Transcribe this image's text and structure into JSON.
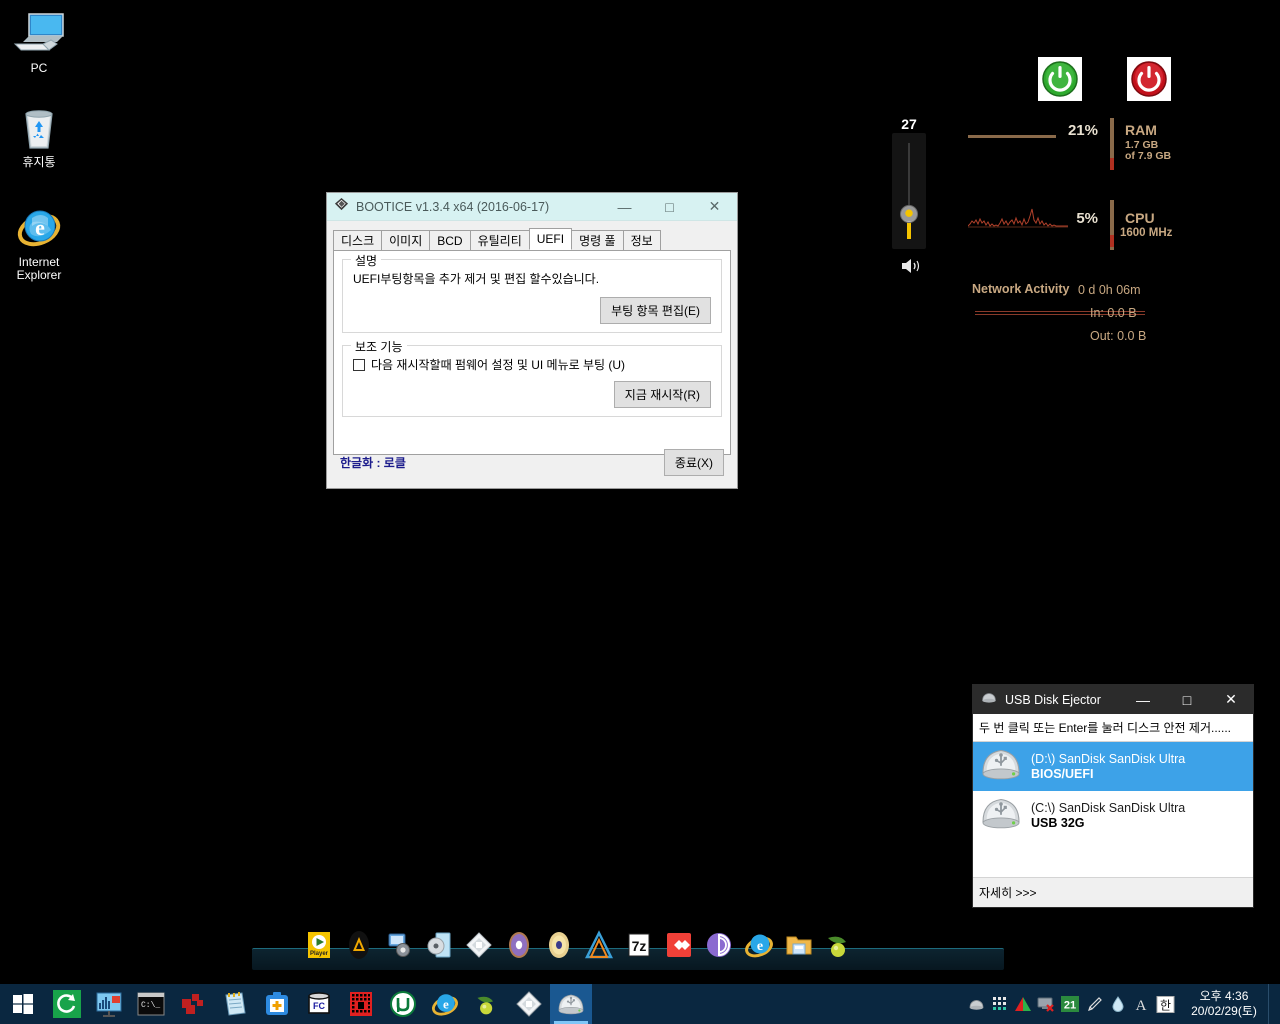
{
  "desktop": {
    "icons": [
      {
        "name": "pc",
        "label": "PC"
      },
      {
        "name": "recycle-bin",
        "label": "휴지통"
      },
      {
        "name": "internet-explorer",
        "label": "Internet\nExplorer"
      }
    ]
  },
  "bootice": {
    "title": "BOOTICE v1.3.4 x64 (2016-06-17)",
    "titlebar_color": "#d7f2f2",
    "minimize": "—",
    "maximize": "□",
    "close": "✕",
    "tabs": [
      {
        "label": "디스크",
        "active": false
      },
      {
        "label": "이미지",
        "active": false
      },
      {
        "label": "BCD",
        "active": false
      },
      {
        "label": "유틸리티",
        "active": false
      },
      {
        "label": "UEFI",
        "active": true
      },
      {
        "label": "명령 풀",
        "active": false
      },
      {
        "label": "정보",
        "active": false
      }
    ],
    "group_description": {
      "legend": "설명",
      "text": "UEFI부팅항목을 추가 제거 및  편집 할수있습니다.",
      "button": "부팅 항목 편집(E)"
    },
    "group_aux": {
      "legend": "보조 기능",
      "checkbox_label": "다음 재시작할때 펌웨어 설정 및 UI 메뉴로 부팅 (U)",
      "checkbox_checked": false,
      "button": "지금 재시작(R)"
    },
    "status_note": "한글화 : 로클",
    "status_note_color": "#1c1c8c",
    "exit_button": "종료(X)"
  },
  "sysmon": {
    "volume_value": "27",
    "ram": {
      "percent": "21%",
      "label": "RAM",
      "used": "1.7 GB",
      "total": "of 7.9 GB",
      "bar_fill": 21
    },
    "cpu": {
      "percent": "5%",
      "label": "CPU",
      "freq": "1600 MHz"
    },
    "network": {
      "label": "Network Activity",
      "uptime": "0 d 0h 06m",
      "in": "In: 0.0 B",
      "out": "Out: 0.0 B"
    },
    "accent_color": "#c8a882",
    "buttons": [
      {
        "name": "restart-power-button",
        "color": "#1f9c20"
      },
      {
        "name": "shutdown-power-button",
        "color": "#c61018"
      }
    ]
  },
  "ejector": {
    "title": "USB Disk Ejector",
    "minimize": "—",
    "maximize": "□",
    "close": "✕",
    "hint": "두 번 클릭 또는 Enter를 눌러 디스크 안전 제거......",
    "devices": [
      {
        "drive": "(D:\\) SanDisk SanDisk Ultra",
        "label": "BIOS/UEFI",
        "selected": true
      },
      {
        "drive": "(C:\\) SanDisk SanDisk Ultra",
        "label": "USB 32G",
        "selected": false
      }
    ],
    "footer": "자세히 >>>",
    "selection_color": "#3da2e8"
  },
  "dock": {
    "items": [
      {
        "name": "dock-media-player",
        "label": "Player"
      },
      {
        "name": "dock-amp-app",
        "label": ""
      },
      {
        "name": "dock-system-settings",
        "label": ""
      },
      {
        "name": "dock-disc-tool",
        "label": ""
      },
      {
        "name": "dock-diamond-app",
        "label": ""
      },
      {
        "name": "dock-dvd-burner",
        "label": ""
      },
      {
        "name": "dock-imgburn",
        "label": ""
      },
      {
        "name": "dock-triangle-app",
        "label": ""
      },
      {
        "name": "dock-7zip",
        "label": "7z"
      },
      {
        "name": "dock-red-app",
        "label": ""
      },
      {
        "name": "dock-bittorrent",
        "label": ""
      },
      {
        "name": "dock-internet-explorer",
        "label": ""
      },
      {
        "name": "dock-file-explorer",
        "label": ""
      },
      {
        "name": "dock-olive-app",
        "label": ""
      }
    ]
  },
  "taskbar": {
    "start_name": "start-button",
    "items": [
      {
        "name": "taskbar-recovery",
        "active": false
      },
      {
        "name": "taskbar-network-monitor",
        "active": false
      },
      {
        "name": "taskbar-command-prompt",
        "active": false
      },
      {
        "name": "taskbar-red-blocks-app",
        "active": false
      },
      {
        "name": "taskbar-notepad",
        "active": false
      },
      {
        "name": "taskbar-first-aid",
        "active": false
      },
      {
        "name": "taskbar-fc-app",
        "active": false
      },
      {
        "name": "taskbar-red-grid-app",
        "active": false
      },
      {
        "name": "taskbar-utorrent",
        "active": false
      },
      {
        "name": "taskbar-internet-explorer",
        "active": false
      },
      {
        "name": "taskbar-olive-app",
        "active": false
      },
      {
        "name": "taskbar-bootice",
        "active": false
      },
      {
        "name": "taskbar-usb-disk-ejector",
        "active": true
      }
    ],
    "tray": [
      {
        "name": "tray-usb-eject-icon",
        "glyph": ""
      },
      {
        "name": "tray-grid-icon",
        "glyph": ""
      },
      {
        "name": "tray-aimp-icon",
        "glyph": ""
      },
      {
        "name": "tray-display-off-icon",
        "glyph": ""
      },
      {
        "name": "tray-count-badge",
        "glyph": "21"
      },
      {
        "name": "tray-pen-icon",
        "glyph": ""
      },
      {
        "name": "tray-drop-icon",
        "glyph": ""
      },
      {
        "name": "tray-font-icon",
        "glyph": "A"
      },
      {
        "name": "tray-ime-korean-icon",
        "glyph": "한"
      }
    ],
    "clock": {
      "time": "오후 4:36",
      "date": "20/02/29(토)"
    }
  }
}
